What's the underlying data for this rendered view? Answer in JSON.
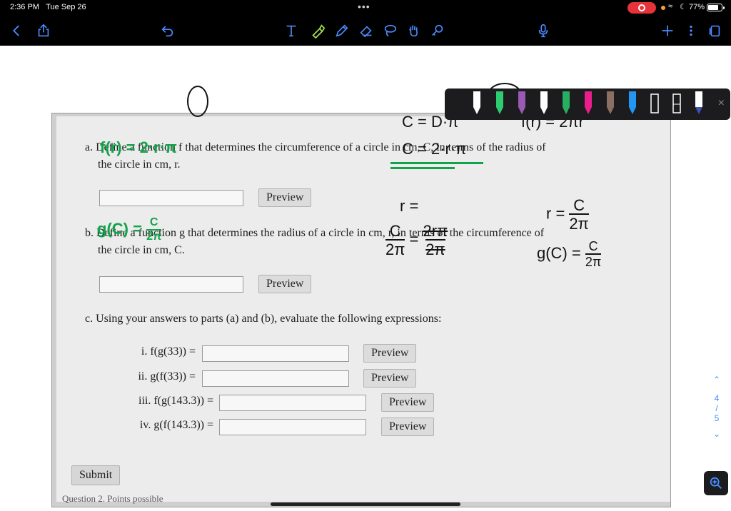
{
  "status_bar": {
    "time": "2:36 PM",
    "date": "Tue Sep 26",
    "dots": "•••",
    "battery_pct": "77%",
    "battery_level": 0.77,
    "record_color": "#e5323b"
  },
  "toolbar": {
    "accent": "#4a8cff",
    "icons": [
      "back-icon",
      "share-icon",
      "undo-icon",
      "text-tool-icon",
      "highlighter-icon",
      "pen-icon",
      "eraser-icon",
      "lasso-icon",
      "hand-icon",
      "pointer-icon",
      "microphone-icon",
      "add-icon",
      "more-icon",
      "copy-icon"
    ]
  },
  "pen_tray": {
    "colors": [
      "#ffffff",
      "#2ecc71",
      "#9b59b6",
      "#ffffff",
      "#27ae60",
      "#e91e8c",
      "#8d6e63",
      "#2196f3",
      "#ffffff",
      "#ffffff",
      "#3f51b5"
    ],
    "close": "×"
  },
  "question": {
    "part_a": {
      "text_line1": "a. Define a function f that determines the circumference of a circle in cm, C, in terms of the radius of",
      "text_line2": "the circle in cm, r.",
      "answer": "f(r) = 2·r·π",
      "preview": "Preview"
    },
    "part_b": {
      "text_line1": "b. Define a function g that determines the radius of a circle in cm, r, in terms of the circumference of",
      "text_line2": "the circle in cm, C.",
      "answer_lhs": "g(C) =",
      "answer_num": "C",
      "answer_den": "2π",
      "preview": "Preview"
    },
    "part_c": {
      "text": "c. Using your answers to parts (a) and (b), evaluate the following expressions:",
      "items": [
        {
          "label": "i. f(g(33)) =",
          "value": "",
          "preview": "Preview"
        },
        {
          "label": "ii. g(f(33)) =",
          "value": "",
          "preview": "Preview"
        },
        {
          "label": "iii. f(g(143.3)) =",
          "value": "",
          "preview": "Preview"
        },
        {
          "label": "iv. g(f(143.3)) =",
          "value": "",
          "preview": "Preview"
        }
      ]
    },
    "submit": "Submit",
    "next_partial": "Question 2. Points possible"
  },
  "handwriting": {
    "ink_green": "#12a34a",
    "c_eq_d_pi": "C = D·π",
    "f_r": "f(r) = 2πr",
    "c_eq_2rpi": "C = 2·r·π",
    "r_eq": "r =",
    "c_frac_num": "C",
    "c_frac_den": "2π",
    "eq_rhs_num": "2rπ",
    "eq_rhs_den": "2π",
    "r_eq_c_lhs": "r =",
    "r_eq_c_num": "C",
    "r_eq_c_den": "2π",
    "g_c_lhs": "g(C) =",
    "g_c_num": "C",
    "g_c_den": "2π"
  },
  "pager": {
    "current": "4",
    "sep": "/",
    "total": "5"
  }
}
